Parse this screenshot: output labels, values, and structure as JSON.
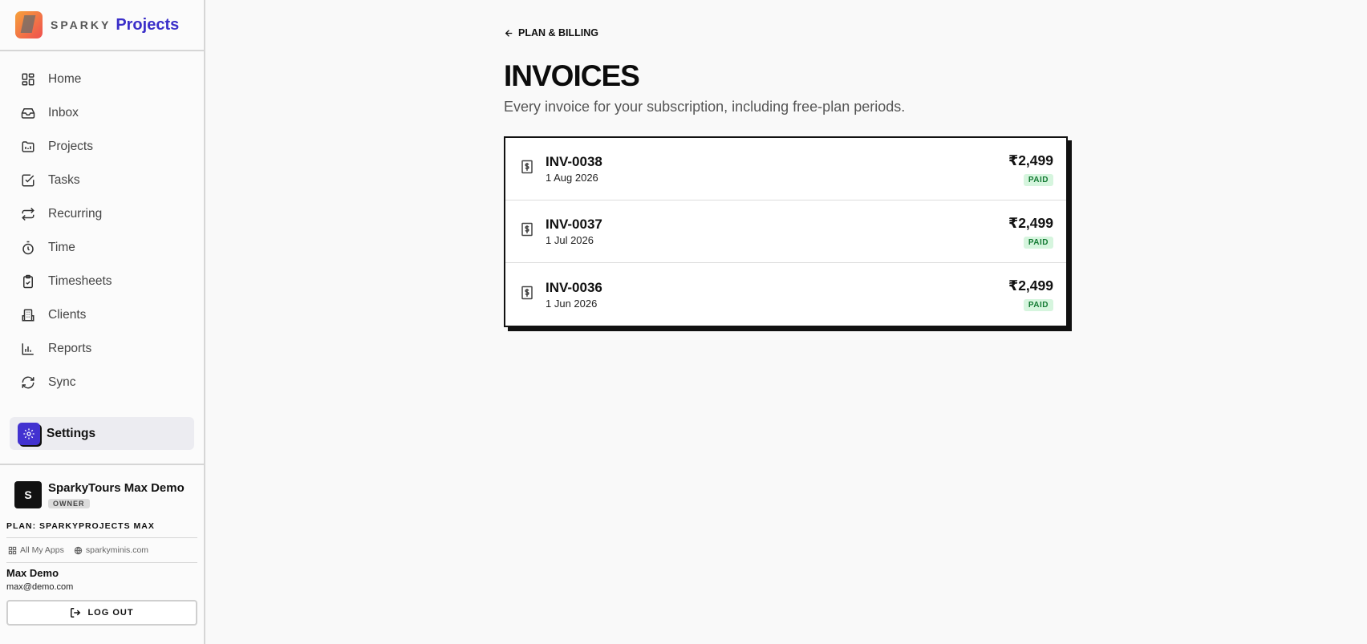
{
  "brand": {
    "word": "SPARKY",
    "product": "Projects"
  },
  "nav": {
    "items": [
      {
        "label": "Home",
        "icon": "dashboard-icon"
      },
      {
        "label": "Inbox",
        "icon": "inbox-icon"
      },
      {
        "label": "Projects",
        "icon": "folder-icon"
      },
      {
        "label": "Tasks",
        "icon": "checkbox-icon"
      },
      {
        "label": "Recurring",
        "icon": "repeat-icon"
      },
      {
        "label": "Time",
        "icon": "stopwatch-icon"
      },
      {
        "label": "Timesheets",
        "icon": "clipboard-check-icon"
      },
      {
        "label": "Clients",
        "icon": "building-icon"
      },
      {
        "label": "Reports",
        "icon": "bar-chart-icon"
      },
      {
        "label": "Sync",
        "icon": "refresh-icon"
      }
    ],
    "settings": {
      "label": "Settings",
      "icon": "gear-icon"
    }
  },
  "account": {
    "org_initial": "S",
    "org_name": "SparkyTours Max Demo",
    "role": "OWNER",
    "plan": "PLAN: SPARKYPROJECTS MAX",
    "links": {
      "apps": "All My Apps",
      "site": "sparkyminis.com"
    },
    "user_name": "Max Demo",
    "user_email": "max@demo.com",
    "logout_label": "LOG OUT"
  },
  "main": {
    "back_label": "PLAN & BILLING",
    "title": "INVOICES",
    "subtitle": "Every invoice for your subscription, including free-plan periods.",
    "invoices": [
      {
        "number": "INV-0038",
        "date": "1 Aug 2026",
        "amount": "₹2,499",
        "status": "PAID"
      },
      {
        "number": "INV-0037",
        "date": "1 Jul 2026",
        "amount": "₹2,499",
        "status": "PAID"
      },
      {
        "number": "INV-0036",
        "date": "1 Jun 2026",
        "amount": "₹2,499",
        "status": "PAID"
      }
    ]
  },
  "colors": {
    "accent": "#3b2fc9",
    "settings_icon_bg": "#4232d0",
    "paid_bg": "#d6f5de",
    "paid_text": "#137a33"
  }
}
